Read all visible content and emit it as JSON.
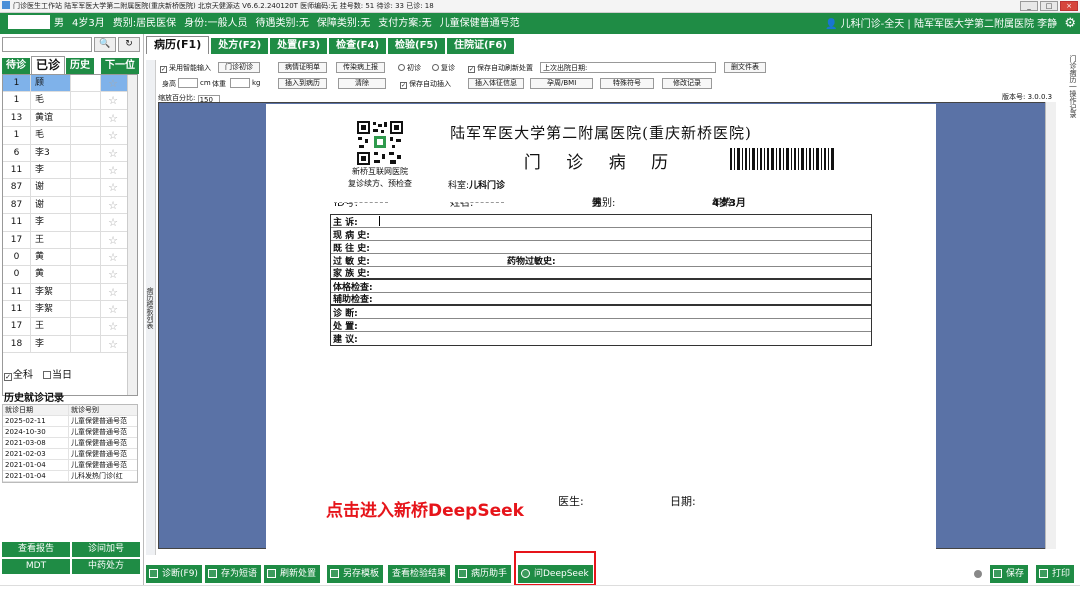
{
  "app": {
    "title": "门诊医生工作站 陆军军医大学第二附属医院(重庆新桥医院) 北京天健源达 V6.6.2.240120T 医师编码:无  挂号数: 51    待诊: 33    已诊: 18"
  },
  "patient_bar": {
    "sex": "男",
    "age": "4岁3月",
    "fee_type": "费别:居民医保",
    "identity": "身份:一般人员",
    "treatment": "待遇类别:无",
    "guarantee": "保障类别:无",
    "payment": "支付方案:无",
    "visit_type": "儿童保健普通号范",
    "dept_user": "儿科门诊-全天 | 陆军军医大学第二附属医院 李静",
    "settings_icon": "gear-icon",
    "user_icon": "user-icon"
  },
  "left": {
    "search_btn": "🔍",
    "refresh_btn": "↻",
    "tabs": [
      "待诊",
      "已诊",
      "历史"
    ],
    "next_label": "下一位",
    "rows": [
      {
        "num": "1",
        "name": "顾"
      },
      {
        "num": "1",
        "name": "毛"
      },
      {
        "num": "13",
        "name": "黄谊"
      },
      {
        "num": "1",
        "name": "毛"
      },
      {
        "num": "6",
        "name": "李3"
      },
      {
        "num": "11",
        "name": "李"
      },
      {
        "num": "87",
        "name": "谢"
      },
      {
        "num": "87",
        "name": "谢"
      },
      {
        "num": "11",
        "name": "李"
      },
      {
        "num": "17",
        "name": "王"
      },
      {
        "num": "0",
        "name": "黄"
      },
      {
        "num": "0",
        "name": "黄"
      },
      {
        "num": "11",
        "name": "李絮"
      },
      {
        "num": "11",
        "name": "李絮"
      },
      {
        "num": "17",
        "name": "王"
      },
      {
        "num": "18",
        "name": "李"
      }
    ],
    "star": "☆",
    "check_all": "全科",
    "check_today": "当日",
    "history_title": "历史就诊记录",
    "history_head": [
      "就诊日期",
      "就诊号别"
    ],
    "history": [
      [
        "2025-02-11",
        "儿童保健普通号范"
      ],
      [
        "2024-10-30",
        "儿童保健普通号范"
      ],
      [
        "2021-03-08",
        "儿童保健普通号范"
      ],
      [
        "2021-02-03",
        "儿童保健普通号范"
      ],
      [
        "2021-01-04",
        "儿童保健普通号范"
      ],
      [
        "2021-01-04",
        "儿科发热门诊(红"
      ]
    ],
    "buttons": [
      "查看报告",
      "诊间加号",
      "MDT",
      "中药处方"
    ]
  },
  "main_tabs": [
    "病历(F1)",
    "处方(F2)",
    "处置(F3)",
    "检查(F4)",
    "检验(F5)",
    "住院证(F6)"
  ],
  "side_strip": "病历模板列表",
  "right_strip": "门诊病历 | 操作记录",
  "toolbar": {
    "smart_input": "采用智能输入",
    "outpatient_first": "门诊初诊",
    "illness_cert": "病情证明单",
    "infection_report": "传染病上报",
    "first_visit": "初诊",
    "return_visit": "复诊",
    "auto_refresh": "保存自动刷新处置",
    "last_out": "上次出院日期:",
    "new_file": "删文件表",
    "height": "身高",
    "cm": "cm",
    "weight": "体重",
    "kg": "kg",
    "insert_record": "插入到病历",
    "clear": "清除",
    "auto_insert": "保存自动插入",
    "insert_sign": "插入体征信息",
    "pregnancy_bmi": "孕周/BMI",
    "special_sym": "特殊符号",
    "modify_log": "修改记录",
    "zoom_label": "缩放百分比:",
    "zoom_value": "150",
    "version": "版本号: 3.0.0.3"
  },
  "doc": {
    "hospital": "陆军军医大学第二附属医院(重庆新桥医院)",
    "title": "门 诊 病 历",
    "qr_cap1": "新桥互联网医院",
    "qr_cap2": "复诊续方、预检查",
    "dept_label": "科室:",
    "dept": "儿科门诊",
    "id_label": "ID号:",
    "name_label": "姓名:",
    "sex_label": "性别:",
    "sex": "男",
    "age_label": "年龄:",
    "age": "4岁3月",
    "fields": [
      "主  诉:",
      "现 病 史:",
      "既 往 史:",
      "过 敏 史:",
      "家 族 史:",
      "体格检查:",
      "辅助检查:",
      "诊   断:",
      "处   置:",
      "建   议:"
    ],
    "drug_allergy": "药物过敏史:",
    "doctor_label": "医生:",
    "date_label": "日期:"
  },
  "promo": "点击进入新桥DeepSeek",
  "bottom": {
    "buttons": [
      "诊断(F9)",
      "存为短语",
      "刷新处置",
      "另存模板",
      "查看检验结果",
      "病历助手",
      "问DeepSeek"
    ],
    "save": "保存",
    "print": "打印"
  }
}
